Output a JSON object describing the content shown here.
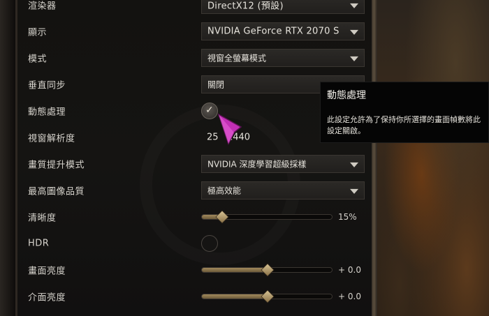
{
  "settings": [
    {
      "label": "渲染器",
      "type": "dropdown",
      "value": "DirectX12 (預設)"
    },
    {
      "label": "顯示",
      "type": "dropdown",
      "value": "NVIDIA GeForce RTX 2070 S"
    },
    {
      "label": "模式",
      "type": "dropdown",
      "value": "視窗全螢幕模式"
    },
    {
      "label": "垂直同步",
      "type": "dropdown",
      "value": "關閉"
    },
    {
      "label": "動態處理",
      "type": "checkbox",
      "checked": true
    },
    {
      "label": "視窗解析度",
      "type": "text",
      "value": "25   1440"
    },
    {
      "label": "畫質提升模式",
      "type": "dropdown",
      "value": "NVIDIA 深度學習超級採樣"
    },
    {
      "label": "最高圖像品質",
      "type": "dropdown",
      "value": "極高效能"
    },
    {
      "label": "清晰度",
      "type": "slider",
      "value": "15%",
      "level": 0.15
    },
    {
      "label": "HDR",
      "type": "checkbox",
      "checked": false
    },
    {
      "label": "畫面亮度",
      "type": "slider",
      "value": "+ 0.0",
      "level": 0.5
    },
    {
      "label": "介面亮度",
      "type": "slider",
      "value": "+ 0.0",
      "level": 0.5
    }
  ],
  "tooltip": {
    "title": "動態處理",
    "body": "此設定允許為了保持你所選擇的畫面幀數將此設定關啟。"
  },
  "icons": {
    "dropdown_arrow": "chevron-down-icon",
    "check": "checkmark-icon",
    "cursor": "pointer-cursor-icon"
  },
  "colors": {
    "accent_gold": "#a28a5c",
    "panel_bg": "#131210",
    "cursor_magenta": "#c22fb5"
  }
}
